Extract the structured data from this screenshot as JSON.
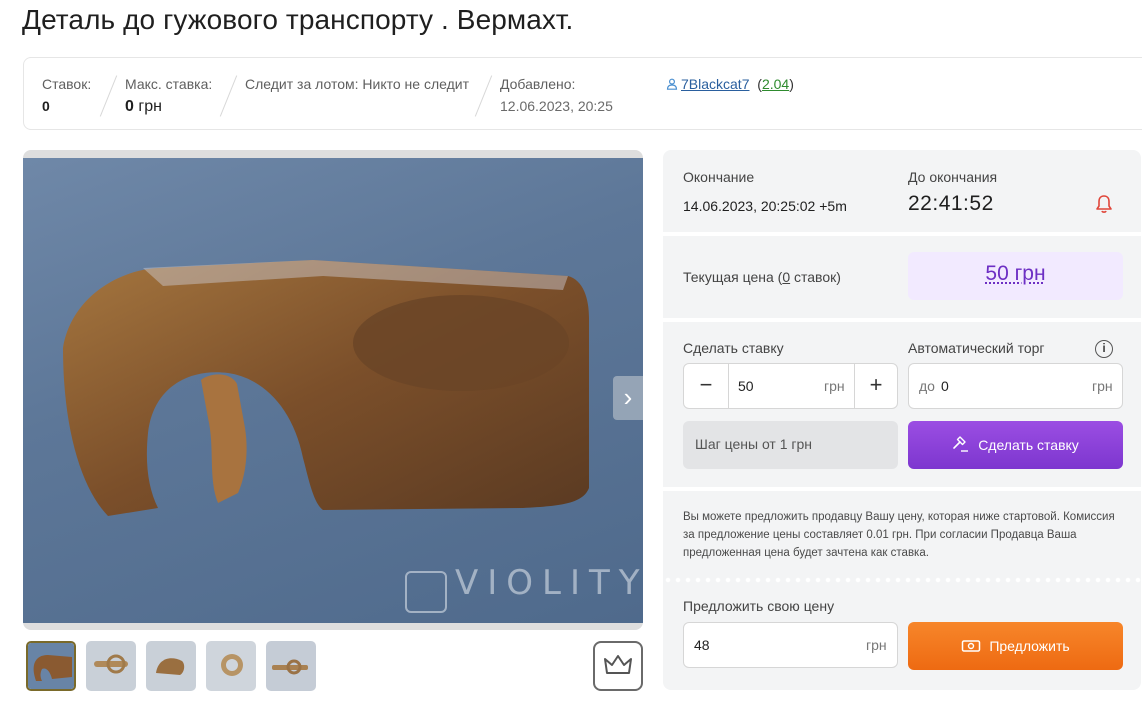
{
  "title": "Деталь до гужового транспорту . Вермахт.",
  "stats": {
    "bids_label": "Ставок:",
    "bids_value": "0",
    "max_bid_label": "Макс. ставка:",
    "max_bid_value": "0",
    "max_bid_unit": "грн",
    "watching": "Следит за лотом: Никто не следит",
    "added_label": "Добавлено:",
    "added_value": "12.06.2023, 20:25",
    "seller_name": "7Blackcat7",
    "seller_rating": "2.04"
  },
  "gallery": {
    "watermark": "VIOLITY",
    "thumbnail_count": 5
  },
  "auction": {
    "ending_label": "Окончание",
    "ending_value": "14.06.2023, 20:25:02 +5m",
    "remaining_label": "До окончания",
    "remaining_value": "22:41:52"
  },
  "price": {
    "label_prefix": "Текущая цена (",
    "label_count": "0",
    "label_suffix": " ставок)",
    "value": "50 грн"
  },
  "bid": {
    "label": "Сделать ставку",
    "value": "50",
    "unit": "грн",
    "minus": "−",
    "plus": "+",
    "auto_label": "Автоматический торг",
    "auto_prefix": "до",
    "auto_value": "0",
    "auto_unit": "грн",
    "step_note": "Шаг цены от 1 грн",
    "button": "Сделать ставку"
  },
  "offer": {
    "note": "Вы можете предложить продавцу Вашу цену, которая ниже стартовой. Комиссия за предложение цены составляет 0.01 грн. При согласии Продавца Ваша предложенная цена будет зачтена как ставка.",
    "label": "Предложить свою цену",
    "value": "48",
    "unit": "грн",
    "button": "Предложить"
  },
  "colors": {
    "accent_purple": "#7d36cf",
    "accent_orange": "#ee6a12",
    "price_text": "#6d2fc4",
    "bell": "#e0463a"
  }
}
